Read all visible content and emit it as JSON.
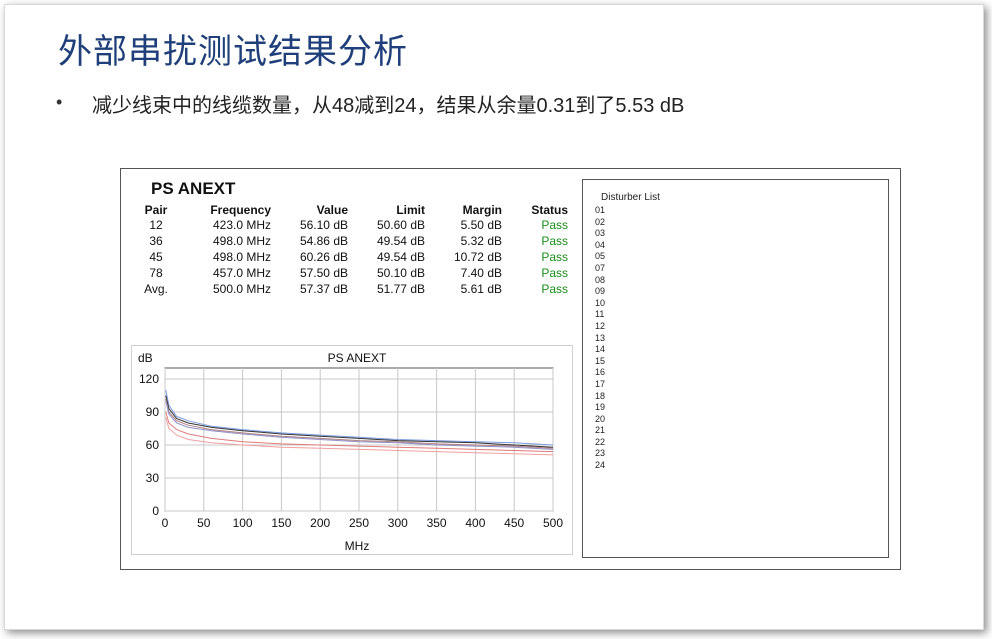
{
  "slide": {
    "title": "外部串扰测试结果分析",
    "bullet_dot": "•",
    "bullet": "减少线束中的线缆数量，从48减到24，结果从余量0.31到了5.53 dB"
  },
  "report": {
    "title": "PS ANEXT",
    "columns": [
      "Pair",
      "Frequency",
      "Value",
      "Limit",
      "Margin",
      "Status"
    ],
    "rows": [
      [
        "12",
        "423.0 MHz",
        "56.10 dB",
        "50.60 dB",
        "5.50 dB",
        "Pass"
      ],
      [
        "36",
        "498.0 MHz",
        "54.86 dB",
        "49.54 dB",
        "5.32 dB",
        "Pass"
      ],
      [
        "45",
        "498.0 MHz",
        "60.26 dB",
        "49.54 dB",
        "10.72 dB",
        "Pass"
      ],
      [
        "78",
        "457.0 MHz",
        "57.50 dB",
        "50.10 dB",
        "7.40 dB",
        "Pass"
      ],
      [
        "Avg.",
        "500.0 MHz",
        "57.37 dB",
        "51.77 dB",
        "5.61 dB",
        "Pass"
      ]
    ],
    "status_color": "#1a8a1a"
  },
  "disturber": {
    "title": "Disturber List",
    "items": [
      "01",
      "02",
      "03",
      "04",
      "05",
      "07",
      "08",
      "09",
      "10",
      "11",
      "12",
      "13",
      "14",
      "15",
      "16",
      "17",
      "18",
      "19",
      "20",
      "21",
      "22",
      "23",
      "24"
    ]
  },
  "chart_data": {
    "type": "line",
    "title": "PS ANEXT",
    "ylabel": "dB",
    "xlabel": "MHz",
    "xlim": [
      0,
      500
    ],
    "ylim": [
      0,
      130
    ],
    "xticks": [
      0,
      50,
      100,
      150,
      200,
      250,
      300,
      350,
      400,
      450,
      500
    ],
    "yticks": [
      0,
      30,
      60,
      90,
      120
    ],
    "grid": true,
    "series": [
      {
        "color": "#7a9ce0",
        "x": [
          1,
          5,
          15,
          30,
          60,
          100,
          150,
          200,
          250,
          300,
          350,
          400,
          450,
          500
        ],
        "y": [
          110,
          96,
          86,
          82,
          77,
          74,
          71,
          69,
          67,
          65,
          64,
          63,
          62,
          60
        ]
      },
      {
        "color": "#333333",
        "x": [
          1,
          5,
          15,
          30,
          60,
          100,
          150,
          200,
          250,
          300,
          350,
          400,
          450,
          500
        ],
        "y": [
          105,
          93,
          84,
          80,
          76,
          73,
          70,
          68,
          66,
          64,
          63,
          62,
          60,
          58
        ]
      },
      {
        "color": "#b08080",
        "x": [
          1,
          5,
          15,
          30,
          60,
          100,
          150,
          200,
          250,
          300,
          350,
          400,
          450,
          500
        ],
        "y": [
          102,
          90,
          82,
          78,
          74,
          71,
          68,
          66,
          64,
          63,
          61,
          60,
          59,
          57
        ]
      },
      {
        "color": "#9090c8",
        "x": [
          1,
          5,
          15,
          30,
          60,
          100,
          150,
          200,
          250,
          300,
          350,
          400,
          450,
          500
        ],
        "y": [
          100,
          88,
          80,
          76,
          73,
          70,
          67,
          65,
          63,
          62,
          60,
          59,
          58,
          56
        ]
      },
      {
        "color": "#e07a7a",
        "x": [
          1,
          5,
          15,
          30,
          60,
          100,
          150,
          200,
          250,
          300,
          350,
          400,
          450,
          500
        ],
        "y": [
          90,
          80,
          74,
          70,
          66,
          63,
          61,
          60,
          59,
          58,
          57,
          56,
          55,
          54
        ]
      },
      {
        "color": "#f0a0a0",
        "x": [
          1,
          5,
          15,
          30,
          60,
          100,
          150,
          200,
          250,
          300,
          350,
          400,
          450,
          500
        ],
        "y": [
          85,
          75,
          69,
          65,
          62,
          60,
          58,
          57,
          56,
          55,
          54,
          53,
          52,
          51
        ]
      }
    ]
  }
}
